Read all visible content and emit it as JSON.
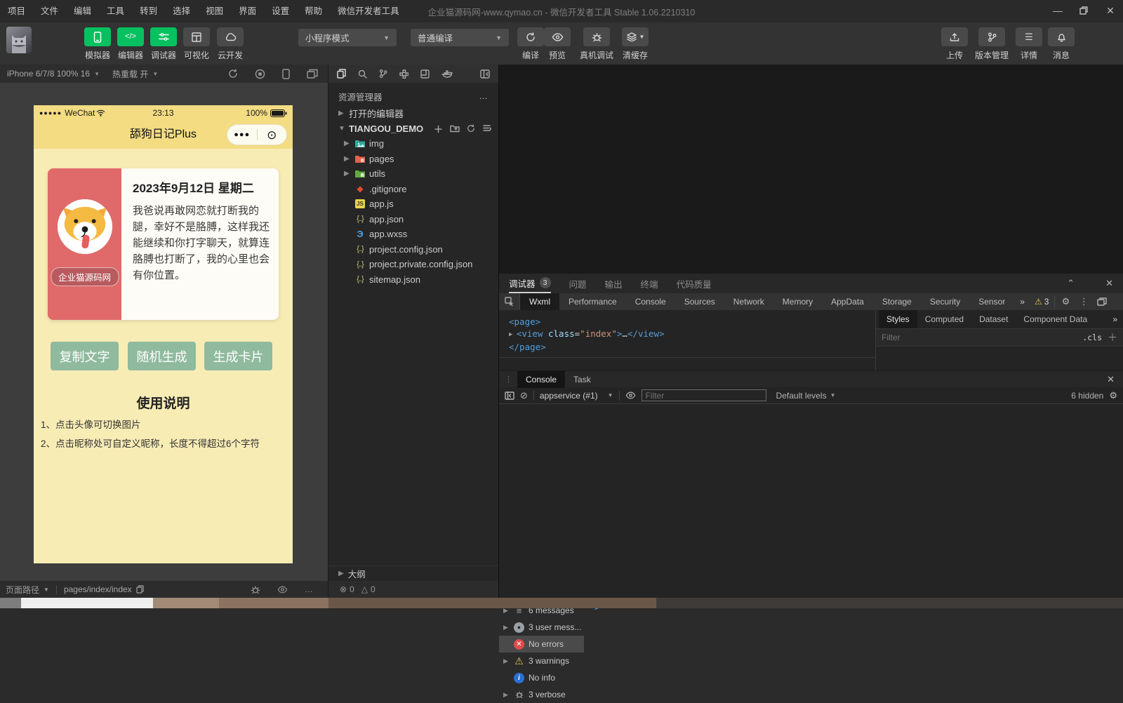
{
  "titlebar": {
    "menus": [
      "项目",
      "文件",
      "编辑",
      "工具",
      "转到",
      "选择",
      "视图",
      "界面",
      "设置",
      "帮助",
      "微信开发者工具"
    ],
    "title": "企业猫源码网-www.qymao.cn - 微信开发者工具 Stable 1.06.2210310"
  },
  "toolbar": {
    "left_buttons": [
      {
        "label": "模拟器"
      },
      {
        "label": "编辑器"
      },
      {
        "label": "调试器"
      },
      {
        "label": "可视化"
      },
      {
        "label": "云开发"
      }
    ],
    "mode_dropdown": "小程序模式",
    "compile_dropdown": "普通编译",
    "actions": [
      {
        "label": "编译"
      },
      {
        "label": "预览"
      },
      {
        "label": "真机调试"
      },
      {
        "label": "清缓存"
      }
    ],
    "right_buttons": [
      {
        "label": "上传"
      },
      {
        "label": "版本管理"
      },
      {
        "label": "详情"
      },
      {
        "label": "消息"
      }
    ]
  },
  "simulator": {
    "device": "iPhone 6/7/8 100% 16",
    "hot_reload": "热重载 开",
    "phone": {
      "carrier": "WeChat",
      "time": "23:13",
      "battery": "100%",
      "app_title": "舔狗日记Plus",
      "card": {
        "date": "2023年9月12日 星期二",
        "text": "我爸说再敢网恋就打断我的腿，幸好不是胳膊，这样我还能继续和你打字聊天，就算连胳膊也打断了，我的心里也会有你位置。",
        "badge": "企业猫源码网"
      },
      "buttons": [
        {
          "label": "复制文字"
        },
        {
          "label": "随机生成"
        },
        {
          "label": "生成卡片"
        }
      ],
      "guide_title": "使用说明",
      "guide_lines": [
        "1、点击头像可切换图片",
        "2、点击昵称处可自定义昵称，长度不得超过6个字符"
      ]
    },
    "statusbar": {
      "path_label": "页面路径",
      "path": "pages/index/index"
    }
  },
  "explorer": {
    "header": "资源管理器",
    "open_editors": "打开的编辑器",
    "project": "TIANGOU_DEMO",
    "items": [
      {
        "name": "img"
      },
      {
        "name": "pages"
      },
      {
        "name": "utils"
      },
      {
        "name": ".gitignore"
      },
      {
        "name": "app.js"
      },
      {
        "name": "app.json"
      },
      {
        "name": "app.wxss"
      },
      {
        "name": "project.config.json"
      },
      {
        "name": "project.private.config.json"
      },
      {
        "name": "sitemap.json"
      }
    ],
    "outline": "大纲",
    "problems": {
      "errors": "0",
      "warnings": "0"
    }
  },
  "debugger": {
    "panel_tabs": [
      {
        "label": "调试器",
        "badge": "3"
      },
      {
        "label": "问题"
      },
      {
        "label": "输出"
      },
      {
        "label": "终端"
      },
      {
        "label": "代码质量"
      }
    ],
    "devtools_tabs": [
      "Wxml",
      "Performance",
      "Console",
      "Sources",
      "Network",
      "Memory",
      "AppData",
      "Storage",
      "Security",
      "Sensor"
    ],
    "overflow": "»",
    "warn_count": "3",
    "wxml_lines": [
      [
        {
          "t": "<page>",
          "c": "tag"
        }
      ],
      [
        {
          "t": "▶ ",
          "c": "dim"
        },
        {
          "t": "<view",
          "c": "tag"
        },
        {
          "t": " class",
          "c": "attr"
        },
        {
          "t": "=",
          "c": "plain"
        },
        {
          "t": "\"index\"",
          "c": "str"
        },
        {
          "t": ">",
          "c": "tag"
        },
        {
          "t": "…",
          "c": "plain"
        },
        {
          "t": "</view>",
          "c": "tag"
        }
      ],
      [
        {
          "t": "</page>",
          "c": "tag"
        }
      ]
    ],
    "styles_tabs": [
      "Styles",
      "Computed",
      "Dataset",
      "Component Data"
    ],
    "styles_filter_placeholder": "Filter",
    "cls_label": ".cls"
  },
  "console": {
    "tabs": [
      {
        "label": "Console"
      },
      {
        "label": "Task"
      }
    ],
    "context": "appservice (#1)",
    "filter_placeholder": "Filter",
    "levels": "Default levels",
    "hidden": "6 hidden",
    "items": [
      {
        "label": "6 messages"
      },
      {
        "label": "3 user mess..."
      },
      {
        "label": "No errors"
      },
      {
        "label": "3 warnings"
      },
      {
        "label": "No info"
      },
      {
        "label": "3 verbose"
      }
    ]
  }
}
